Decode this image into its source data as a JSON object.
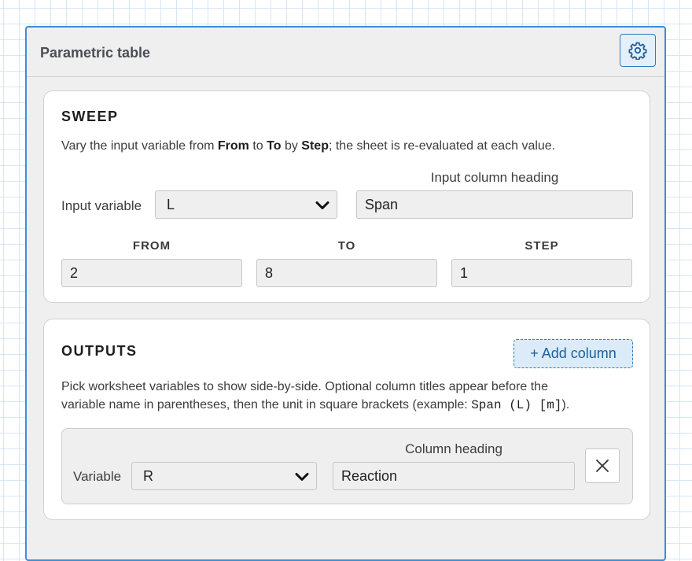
{
  "panel": {
    "title": "Parametric table",
    "settings_icon": "gear-icon"
  },
  "sweep": {
    "title": "SWEEP",
    "desc_pre": "Vary the input variable from ",
    "desc_from": "From",
    "desc_mid1": " to ",
    "desc_to": "To",
    "desc_mid2": " by ",
    "desc_step": "Step",
    "desc_post": "; the sheet is re-evaluated at each value.",
    "input_variable_label": "Input variable",
    "input_variable_value": "L",
    "input_heading_label": "Input column heading",
    "input_heading_value": "Span",
    "from_label": "FROM",
    "from_value": "2",
    "to_label": "TO",
    "to_value": "8",
    "step_label": "STEP",
    "step_value": "1"
  },
  "outputs": {
    "title": "OUTPUTS",
    "add_column_label": "+ Add column",
    "desc_line1": "Pick worksheet variables to show side-by-side. Optional column titles appear before the",
    "desc_line2_pre": "variable name in parentheses, then the unit in square brackets (example: ",
    "desc_example": "Span (L) [m]",
    "desc_line2_post": ").",
    "rows": [
      {
        "variable_label": "Variable",
        "variable_value": "R",
        "heading_label": "Column heading",
        "heading_value": "Reaction",
        "remove_icon": "close-icon"
      }
    ]
  }
}
